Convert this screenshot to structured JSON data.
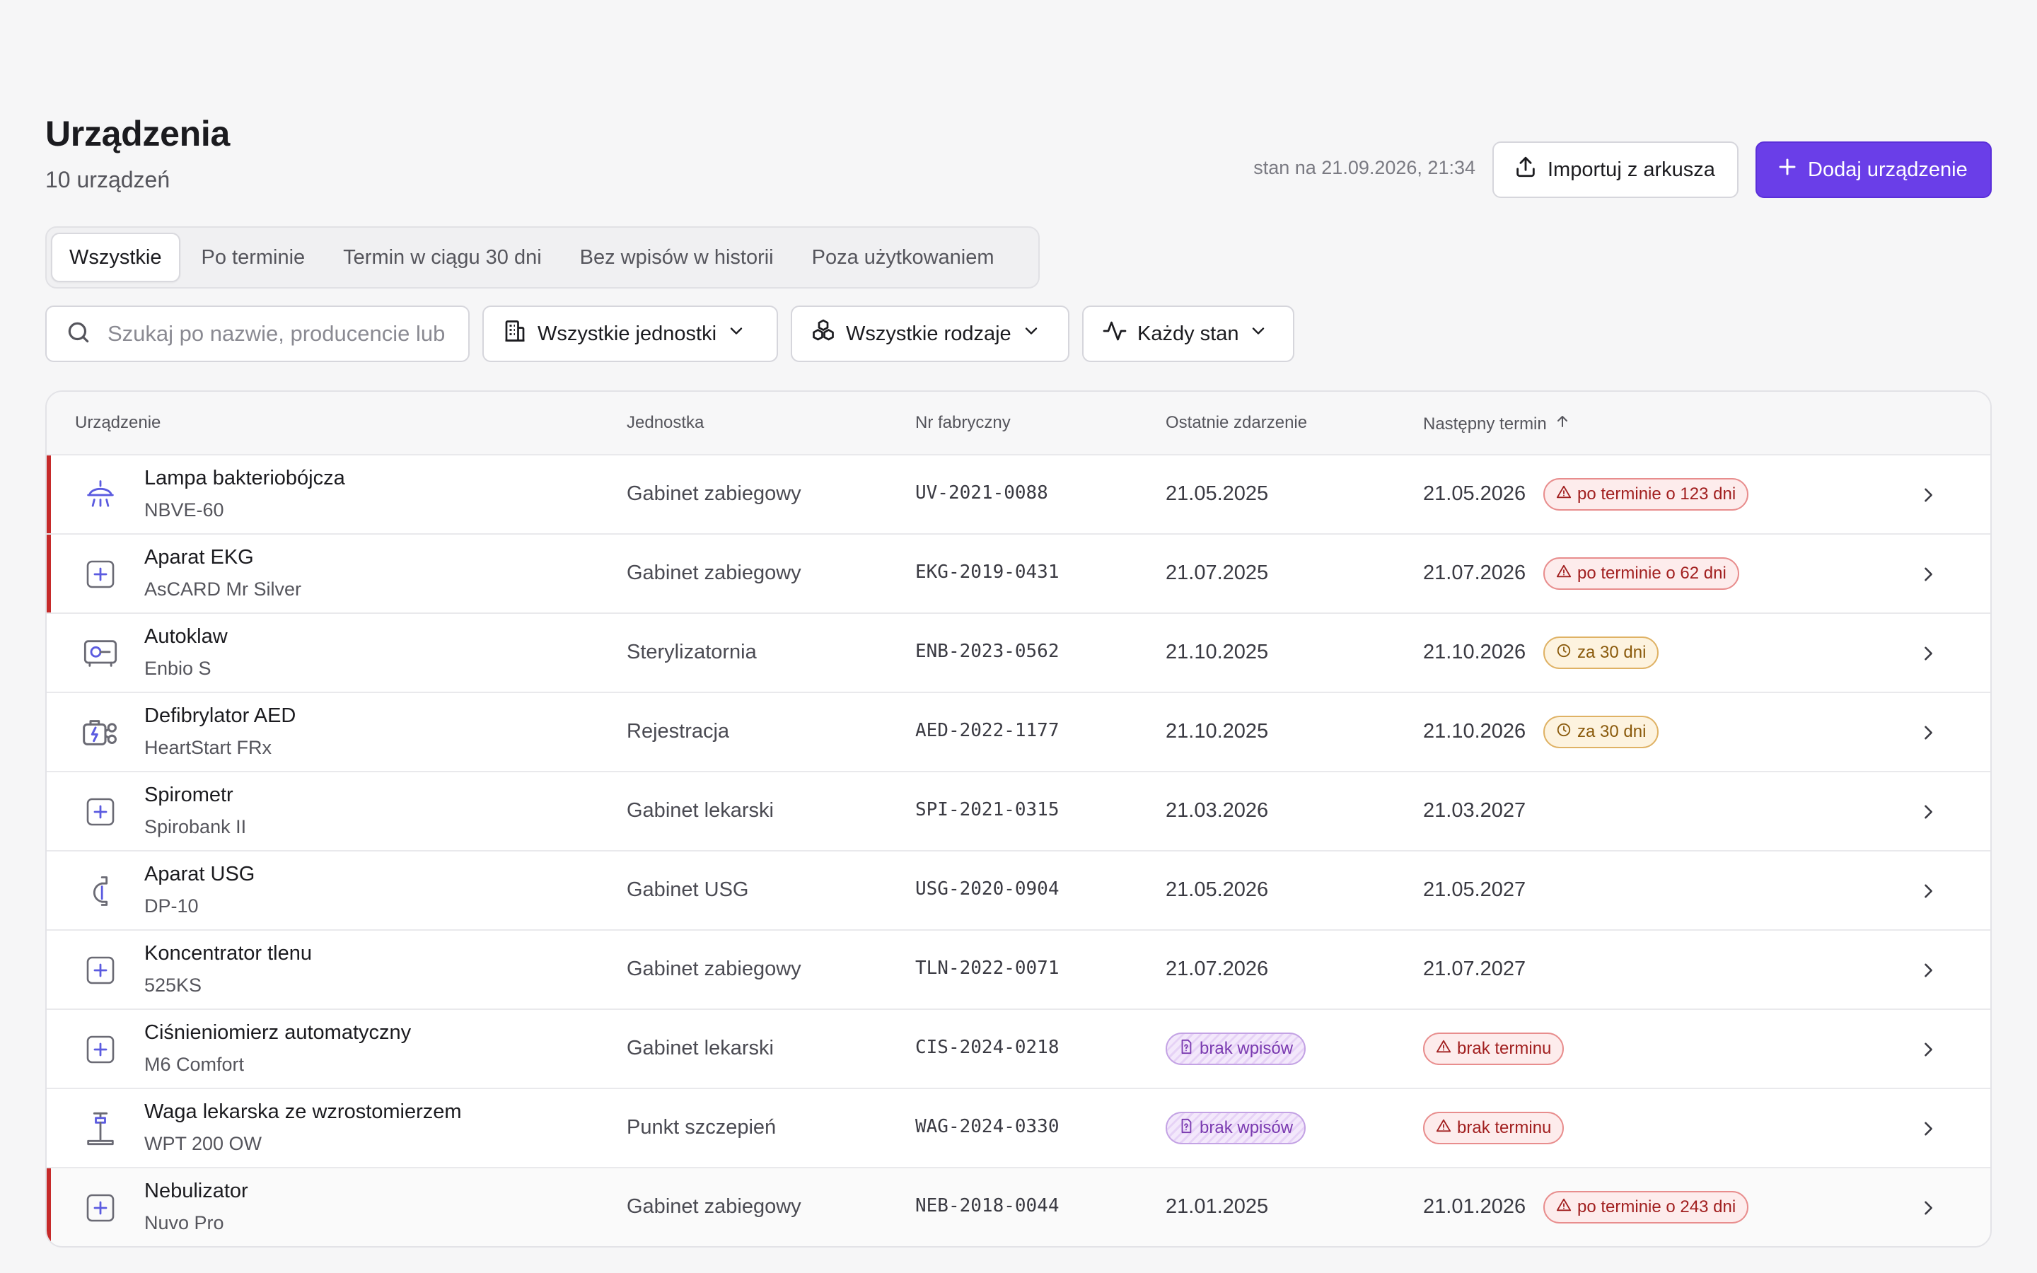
{
  "header": {
    "title": "Urządzenia",
    "count": "10 urządzeń",
    "stamp": "stan na 21.09.2026, 21:34",
    "import_label": "Importuj z arkusza",
    "add_label": "Dodaj urządzenie"
  },
  "tabs": [
    "Wszystkie",
    "Po terminie",
    "Termin w ciągu 30 dni",
    "Bez wpisów w historii",
    "Poza użytkowaniem"
  ],
  "active_tab": "Wszystkie",
  "filters": {
    "search_placeholder": "Szukaj po nazwie, producencie lub",
    "unit": "Wszystkie jednostki",
    "kind": "Wszystkie rodzaje",
    "state": "Każdy stan"
  },
  "table": {
    "columns": [
      "Urządzenie",
      "Jednostka",
      "Nr fabryczny",
      "Ostatnie zdarzenie",
      "Następny termin"
    ],
    "sort_column": "Następny termin",
    "sort_direction": "ascending",
    "rows": [
      {
        "name": "Lampa bakteriobójcza",
        "model": "NBVE-60",
        "unit": "Gabinet zabiegowy",
        "serial": "UV-2021-0088",
        "last": "21.05.2025",
        "next": "21.05.2026",
        "badge": "po terminie o 123 dni",
        "icon": "uv-lamp-icon"
      },
      {
        "name": "Aparat EKG",
        "model": "AsCARD Mr Silver",
        "unit": "Gabinet zabiegowy",
        "serial": "EKG-2019-0431",
        "last": "21.07.2025",
        "next": "21.07.2026",
        "badge": "po terminie o 62 dni",
        "icon": "medical-plus-icon"
      },
      {
        "name": "Autoklaw",
        "model": "Enbio S",
        "unit": "Sterylizatornia",
        "serial": "ENB-2023-0562",
        "last": "21.10.2025",
        "next": "21.10.2026",
        "badge": "za 30 dni",
        "icon": "autoclave-icon"
      },
      {
        "name": "Defibrylator AED",
        "model": "HeartStart FRx",
        "unit": "Rejestracja",
        "serial": "AED-2022-1177",
        "last": "21.10.2025",
        "next": "21.10.2026",
        "badge": "za 30 dni",
        "icon": "defibrillator-icon"
      },
      {
        "name": "Spirometr",
        "model": "Spirobank II",
        "unit": "Gabinet lekarski",
        "serial": "SPI-2021-0315",
        "last": "21.03.2026",
        "next": "21.03.2027",
        "icon": "medical-plus-icon"
      },
      {
        "name": "Aparat USG",
        "model": "DP-10",
        "unit": "Gabinet USG",
        "serial": "USG-2020-0904",
        "last": "21.05.2026",
        "next": "21.05.2027",
        "icon": "ultrasound-probe-icon"
      },
      {
        "name": "Koncentrator tlenu",
        "model": "525KS",
        "unit": "Gabinet zabiegowy",
        "serial": "TLN-2022-0071",
        "last": "21.07.2026",
        "next": "21.07.2027",
        "icon": "medical-plus-icon"
      },
      {
        "name": "Ciśnieniomierz automatyczny",
        "model": "M6 Comfort",
        "unit": "Gabinet lekarski",
        "serial": "CIS-2024-0218",
        "last_badge": "brak wpisów",
        "next_badge": "brak terminu",
        "icon": "medical-plus-icon"
      },
      {
        "name": "Waga lekarska ze wzrostomierzem",
        "model": "WPT 200 OW",
        "unit": "Punkt szczepień",
        "serial": "WAG-2024-0330",
        "last_badge": "brak wpisów",
        "next_badge": "brak terminu",
        "icon": "scale-icon"
      },
      {
        "name": "Nebulizator",
        "model": "Nuvo Pro",
        "unit": "Gabinet zabiegowy",
        "serial": "NEB-2018-0044",
        "last": "21.01.2025",
        "next": "21.01.2026",
        "badge": "po terminie o 243 dni",
        "icon": "medical-plus-icon"
      }
    ]
  },
  "colors": {
    "accent": "#6a3ee8",
    "overdue": "#c62a2a",
    "soon": "#dfb265",
    "no_entries": "#7a3ab0"
  }
}
